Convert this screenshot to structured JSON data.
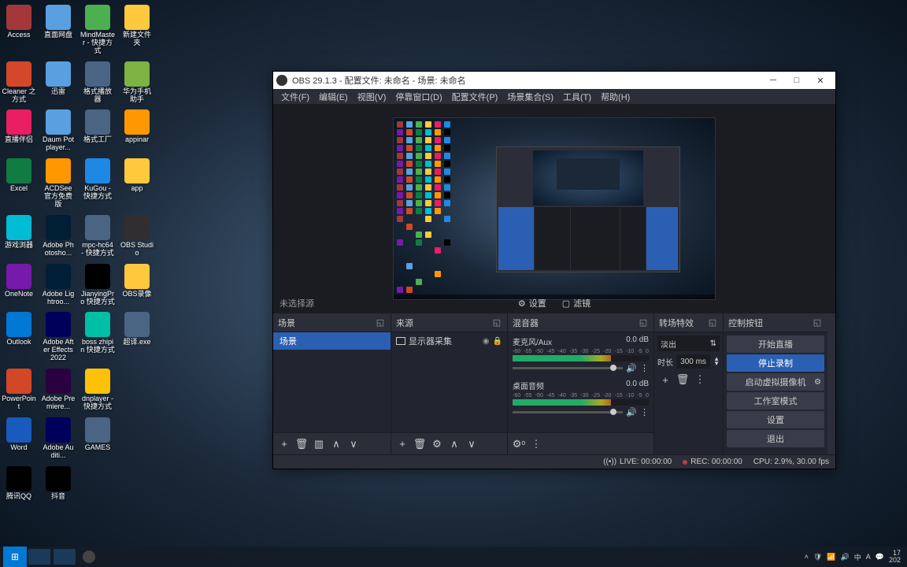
{
  "desktop_icons": [
    [
      {
        "label": "Access",
        "color": "#a4373a"
      },
      {
        "label": "直面网盘",
        "color": "#5aa0e0"
      },
      {
        "label": "MindMaster - 快捷方式",
        "color": "#4caf50"
      },
      {
        "label": "新建文件夹",
        "color": "#ffc83d"
      }
    ],
    [
      {
        "label": "Cleaner 之方式",
        "color": "#d4472a"
      },
      {
        "label": "迅雷",
        "color": "#5aa0e0"
      },
      {
        "label": "格式播放器",
        "color": "#4a6584"
      },
      {
        "label": "华为手机助手",
        "color": "#7cb342"
      }
    ],
    [
      {
        "label": "直播伴侣",
        "color": "#e91e63"
      },
      {
        "label": "Daum Potplayer...",
        "color": "#5aa0e0"
      },
      {
        "label": "格式工厂",
        "color": "#4a6584"
      },
      {
        "label": "appinar",
        "color": "#ff9800"
      }
    ],
    [
      {
        "label": "Excel",
        "color": "#107c41"
      },
      {
        "label": "ACDSee 官方免费版",
        "color": "#ff9800"
      },
      {
        "label": "KuGou - 快捷方式",
        "color": "#1e88e5"
      },
      {
        "label": "app",
        "color": "#ffc83d"
      }
    ],
    [
      {
        "label": "游戏浏器",
        "color": "#00bcd4"
      },
      {
        "label": "Adobe Photosho...",
        "color": "#001e36"
      },
      {
        "label": "mpc-hc64 - 快捷方式",
        "color": "#4a6584"
      },
      {
        "label": "OBS Studio",
        "color": "#302e31"
      }
    ],
    [
      {
        "label": "OneNote",
        "color": "#7719aa"
      },
      {
        "label": "Adobe Lightroo...",
        "color": "#001e36"
      },
      {
        "label": "JianyingPro 快捷方式",
        "color": "#000"
      },
      {
        "label": "OBS录像",
        "color": "#ffc83d"
      }
    ],
    [
      {
        "label": "Outlook",
        "color": "#0078d4"
      },
      {
        "label": "Adobe After Effects 2022",
        "color": "#00005b"
      },
      {
        "label": "boss zhipin 快捷方式",
        "color": "#00bfa5"
      },
      {
        "label": "超译.exe",
        "color": "#4a6584"
      }
    ],
    [
      {
        "label": "PowerPoint",
        "color": "#d24726"
      },
      {
        "label": "Adobe Premiere...",
        "color": "#2a0040"
      },
      {
        "label": "dnplayer - 快捷方式",
        "color": "#ffc107"
      },
      {
        "label": "",
        "color": ""
      }
    ],
    [
      {
        "label": "Word",
        "color": "#185abd"
      },
      {
        "label": "Adobe Auditi...",
        "color": "#00005b"
      },
      {
        "label": "GAMES",
        "color": "#4a6584"
      },
      {
        "label": "",
        "color": ""
      }
    ],
    [
      {
        "label": "腾讯QQ",
        "color": "#000"
      },
      {
        "label": "抖音",
        "color": "#000"
      },
      {
        "label": "",
        "color": ""
      },
      {
        "label": "",
        "color": ""
      }
    ]
  ],
  "obs": {
    "title": "OBS 29.1.3 - 配置文件: 未命名 - 场景: 未命名",
    "menu": [
      "文件(F)",
      "编辑(E)",
      "视图(V)",
      "停靠窗口(D)",
      "配置文件(P)",
      "场景集合(S)",
      "工具(T)",
      "帮助(H)"
    ],
    "preview_label": "未选择源",
    "preview_tools": {
      "settings": "设置",
      "filters": "滤镜"
    },
    "panels": {
      "scenes": {
        "title": "场景",
        "item": "场景"
      },
      "sources": {
        "title": "来源",
        "item": "显示器采集"
      },
      "mixer": {
        "title": "混音器",
        "channels": [
          {
            "name": "麦克风/Aux",
            "level": "0.0 dB"
          },
          {
            "name": "桌面音频",
            "level": "0.0 dB"
          }
        ],
        "scale": [
          "-60",
          "-55",
          "-50",
          "-45",
          "-40",
          "-35",
          "-30",
          "-25",
          "-20",
          "-15",
          "-10",
          "-5",
          "0"
        ]
      },
      "transitions": {
        "title": "转场特效",
        "mode": "淡出",
        "dur_label": "时长",
        "dur_value": "300 ms"
      },
      "controls": {
        "title": "控制按钮",
        "start_stream": "开始直播",
        "stop_record": "停止录制",
        "virtual_cam": "启动虚拟摄像机",
        "studio": "工作室模式",
        "settings": "设置",
        "exit": "退出"
      }
    },
    "status": {
      "live": "LIVE: 00:00:00",
      "rec": "REC: 00:00:00",
      "cpu": "CPU: 2.9%, 30.00 fps"
    }
  },
  "taskbar": {
    "time_top": "17",
    "time_bot": "202"
  }
}
